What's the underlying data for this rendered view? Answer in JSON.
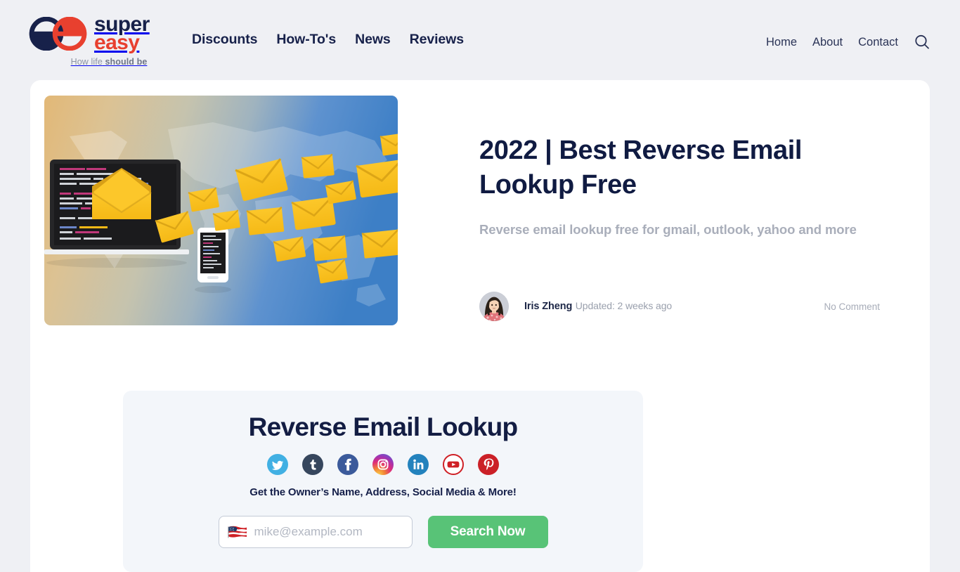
{
  "theme": {
    "page_bg": "#eff0f4",
    "card_bg": "#ffffff",
    "brand_navy": "#17214a",
    "brand_red": "#e8402f",
    "accent_green": "#58c377",
    "muted_text": "#a9aeba",
    "widget_bg": "#f3f6fa"
  },
  "header": {
    "logo": {
      "word_top": "super",
      "word_bottom": "easy",
      "mark_icon": "superesay-double-e-logo-icon",
      "tagline_light": "How life",
      "tagline_bold": "should be"
    },
    "main_nav": [
      {
        "label": "Discounts"
      },
      {
        "label": "How-To's"
      },
      {
        "label": "News"
      },
      {
        "label": "Reviews"
      }
    ],
    "util_nav": [
      {
        "label": "Home"
      },
      {
        "label": "About"
      },
      {
        "label": "Contact"
      }
    ],
    "search_icon": "search-icon"
  },
  "article": {
    "hero_image_alt": "email-envelopes-world-map-illustration",
    "title": "2022 | Best Reverse Email Lookup Free",
    "subtitle": "Reverse email lookup free for gmail, outlook, yahoo and more",
    "author": {
      "avatar_icon": "author-avatar-photo",
      "name": "Iris Zheng",
      "updated": "Updated: 2 weeks ago"
    },
    "comment_status": "No Comment"
  },
  "lookup_widget": {
    "title": "Reverse Email Lookup",
    "pitch": "Get the Owner’s Name, Address, Social Media & More!",
    "social_links": [
      {
        "name": "twitter-icon",
        "label": "Twitter",
        "color": "#41b0e3"
      },
      {
        "name": "tumblr-icon",
        "label": "Tumblr",
        "color": "#36465d"
      },
      {
        "name": "facebook-icon",
        "label": "Facebook",
        "color": "#3b5a9b"
      },
      {
        "name": "instagram-icon",
        "label": "Instagram",
        "color": "#d63a7f"
      },
      {
        "name": "linkedin-icon",
        "label": "LinkedIn",
        "color": "#2382bd"
      },
      {
        "name": "youtube-icon",
        "label": "YouTube",
        "color": "#cf2026"
      },
      {
        "name": "pinterest-icon",
        "label": "Pinterest",
        "color": "#cb2027"
      }
    ],
    "email_input": {
      "value": "",
      "placeholder": "mike@example.com",
      "flag_icon": "us-flag-icon"
    },
    "submit_label": "Search Now"
  }
}
